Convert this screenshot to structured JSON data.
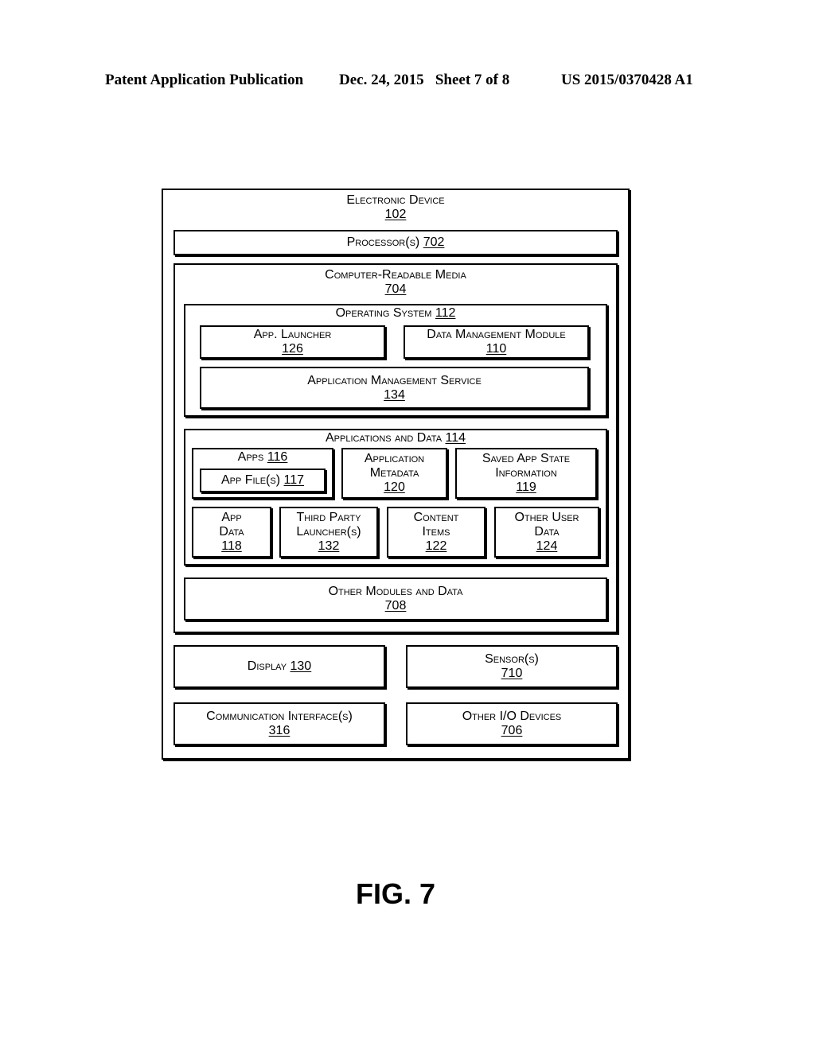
{
  "header": {
    "publication": "Patent Application Publication",
    "date_sheet": "Dec. 24, 2015   Sheet 7 of 8",
    "patent_number": "US 2015/0370428 A1"
  },
  "diagram": {
    "device": {
      "label": "Electronic Device",
      "ref": "102"
    },
    "processor": {
      "label": "Processor(s)",
      "ref": "702"
    },
    "crm": {
      "label": "Computer-Readable Media",
      "ref": "704"
    },
    "os": {
      "label": "Operating System",
      "ref": "112"
    },
    "app_launcher": {
      "label": "App. Launcher",
      "ref": "126"
    },
    "data_mgmt": {
      "label": "Data Management Module",
      "ref": "110"
    },
    "app_mgmt_service": {
      "label": "Application Management Service",
      "ref": "134"
    },
    "apps_and_data": {
      "label": "Applications and Data",
      "ref": "114"
    },
    "apps": {
      "label": "Apps",
      "ref": "116"
    },
    "app_files": {
      "label": "App File(s)",
      "ref": "117"
    },
    "app_metadata": {
      "line1": "Application",
      "line2": "Metadata",
      "ref": "120"
    },
    "saved_state": {
      "line1": "Saved App State",
      "line2": "Information",
      "ref": "119"
    },
    "app_data": {
      "line1": "App",
      "line2": "Data",
      "ref": "118"
    },
    "third_party": {
      "line1": "Third Party",
      "line2": "Launcher(s)",
      "ref": "132"
    },
    "content_items": {
      "line1": "Content",
      "line2": "Items",
      "ref": "122"
    },
    "other_user_data": {
      "line1": "Other User",
      "line2": "Data",
      "ref": "124"
    },
    "other_modules": {
      "label": "Other Modules and Data",
      "ref": "708"
    },
    "display": {
      "label": "Display",
      "ref": "130"
    },
    "sensors": {
      "label": "Sensor(s)",
      "ref": "710"
    },
    "comm_interfaces": {
      "label": "Communication Interface(s)",
      "ref": "316"
    },
    "other_io": {
      "label": "Other I/O Devices",
      "ref": "706"
    }
  },
  "figure_label": "FIG. 7"
}
